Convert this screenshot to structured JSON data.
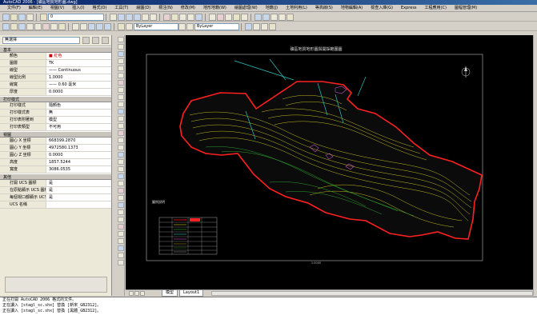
{
  "window": {
    "title": "AutoCAD 2006 - [礦區地質地形圖.dwg]"
  },
  "menu": [
    "文件(F)",
    "編輯(E)",
    "視圖(V)",
    "插入(I)",
    "格式(O)",
    "工具(T)",
    "繪圖(D)",
    "標注(N)",
    "修改(M)",
    "地形地籍(W)",
    "繪圖處理(W)",
    "地籍(J)",
    "土地利用(L)",
    "等高線(S)",
    "地物編輯(A)",
    "檢查入庫(G)",
    "Express",
    "工程應用(C)",
    "圖幅管理(M)"
  ],
  "toolbar": {
    "layer_combo": "0",
    "color_combo": "ByLayer",
    "linetype_combo": "ByLayer"
  },
  "properties": {
    "selector": "無選擇",
    "sections": {
      "general": {
        "title": "基本",
        "rows": [
          {
            "key": "顏色",
            "value": "■ 紅色"
          },
          {
            "key": "圖層",
            "value": "TK"
          },
          {
            "key": "線型",
            "value": "—— Continuous"
          },
          {
            "key": "線型比例",
            "value": "1.0000"
          },
          {
            "key": "線寬",
            "value": "—— 0.60 毫米"
          },
          {
            "key": "厚度",
            "value": "0.0000"
          }
        ]
      },
      "print": {
        "title": "打印樣式",
        "rows": [
          {
            "key": "打印樣式",
            "value": "隨顏色"
          },
          {
            "key": "打印樣式表",
            "value": "無"
          },
          {
            "key": "打印表附著到",
            "value": "模型"
          },
          {
            "key": "打印表類型",
            "value": "不可用"
          }
        ]
      },
      "view": {
        "title": "視圖",
        "rows": [
          {
            "key": "圓心 X 坐標",
            "value": "668399.2870"
          },
          {
            "key": "圓心 Y 坐標",
            "value": "4972580.1373"
          },
          {
            "key": "圓心 Z 坐標",
            "value": "0.0000"
          },
          {
            "key": "高度",
            "value": "1857.5244"
          },
          {
            "key": "寬度",
            "value": "3086.0535"
          }
        ]
      },
      "other": {
        "title": "其他",
        "rows": [
          {
            "key": "打開 UCS 圖標",
            "value": "是"
          },
          {
            "key": "在原點顯示 UCS 圖標",
            "value": "是"
          },
          {
            "key": "每個視口都顯示 UCS",
            "value": "是"
          },
          {
            "key": "UCS 名稱",
            "value": ""
          }
        ]
      }
    }
  },
  "drawing": {
    "title": "礦區地質地形圖與開採範圍圖",
    "side_title": "圖例說明",
    "scale_text": "1:5000",
    "legend_rows": 8,
    "background": "#000000",
    "boundary_color": "#ff2020",
    "contour_yellow": "#d8d020",
    "contour_green": "#30b030",
    "road_cyan": "#30c0c0"
  },
  "tabs": {
    "model": "模型",
    "layout1": "Layout1"
  },
  "command": {
    "lines": [
      "正在打開 AutoCAD 2006 格式的文件。",
      "正在讀入 [stagl_sc.shx] 替換 [新宋_GB2312]。",
      "正在讀入 [stagl_sc.shx] 替換 [黑體_GB2312]。"
    ]
  }
}
